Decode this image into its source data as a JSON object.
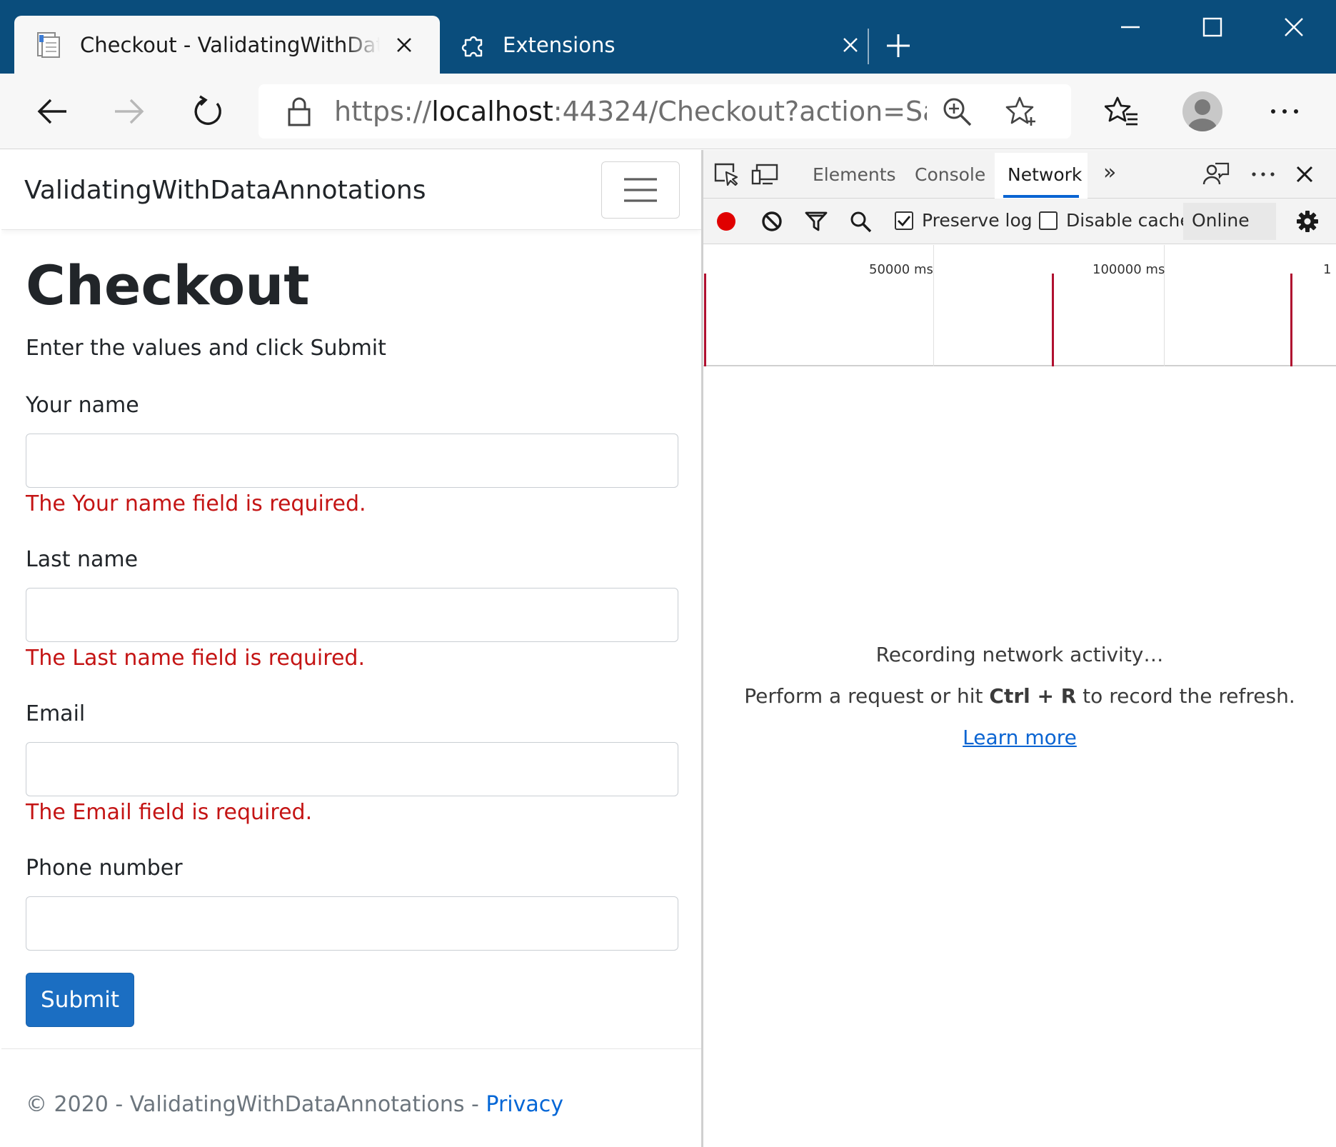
{
  "browser": {
    "tabs": [
      {
        "title": "Checkout - ValidatingWithDataAnnotations",
        "icon": "page-icon",
        "active": true
      },
      {
        "title": "Extensions",
        "icon": "puzzle-icon",
        "active": false
      }
    ],
    "address": {
      "scheme": "https://",
      "host": "localhost",
      "rest": ":44324/Checkout?action=Sa…"
    }
  },
  "page": {
    "brand": "ValidatingWithDataAnnotations",
    "heading": "Checkout",
    "lead": "Enter the values and click Submit",
    "fields": [
      {
        "label": "Your name",
        "value": "",
        "error": "The Your name field is required."
      },
      {
        "label": "Last name",
        "value": "",
        "error": "The Last name field is required."
      },
      {
        "label": "Email",
        "value": "",
        "error": "The Email field is required."
      },
      {
        "label": "Phone number",
        "value": "",
        "error": ""
      }
    ],
    "submit_label": "Submit",
    "footer": {
      "text": "© 2020 - ValidatingWithDataAnnotations - ",
      "link": "Privacy"
    }
  },
  "devtools": {
    "tabs": [
      "Elements",
      "Console",
      "Network"
    ],
    "active_tab": "Network",
    "more_tabs": "»",
    "filters": {
      "preserve_log": {
        "label": "Preserve log",
        "checked": true
      },
      "disable_cache": {
        "label": "Disable cache",
        "checked": false
      },
      "throttling": "Online"
    },
    "overview": {
      "ticks": [
        "50000 ms",
        "100000 ms",
        "1"
      ]
    },
    "empty_state": {
      "line1": "Recording network activity…",
      "line2_pre": "Perform a request or hit ",
      "line2_key1": "Ctrl",
      "line2_plus": " + ",
      "line2_key2": "R",
      "line2_post": " to record the refresh.",
      "link": "Learn more"
    }
  },
  "colors": {
    "titlebar": "#0a4d7c",
    "error": "#c41414",
    "primary": "#1b6ec2",
    "link": "#0366d6",
    "record": "#e00000"
  }
}
